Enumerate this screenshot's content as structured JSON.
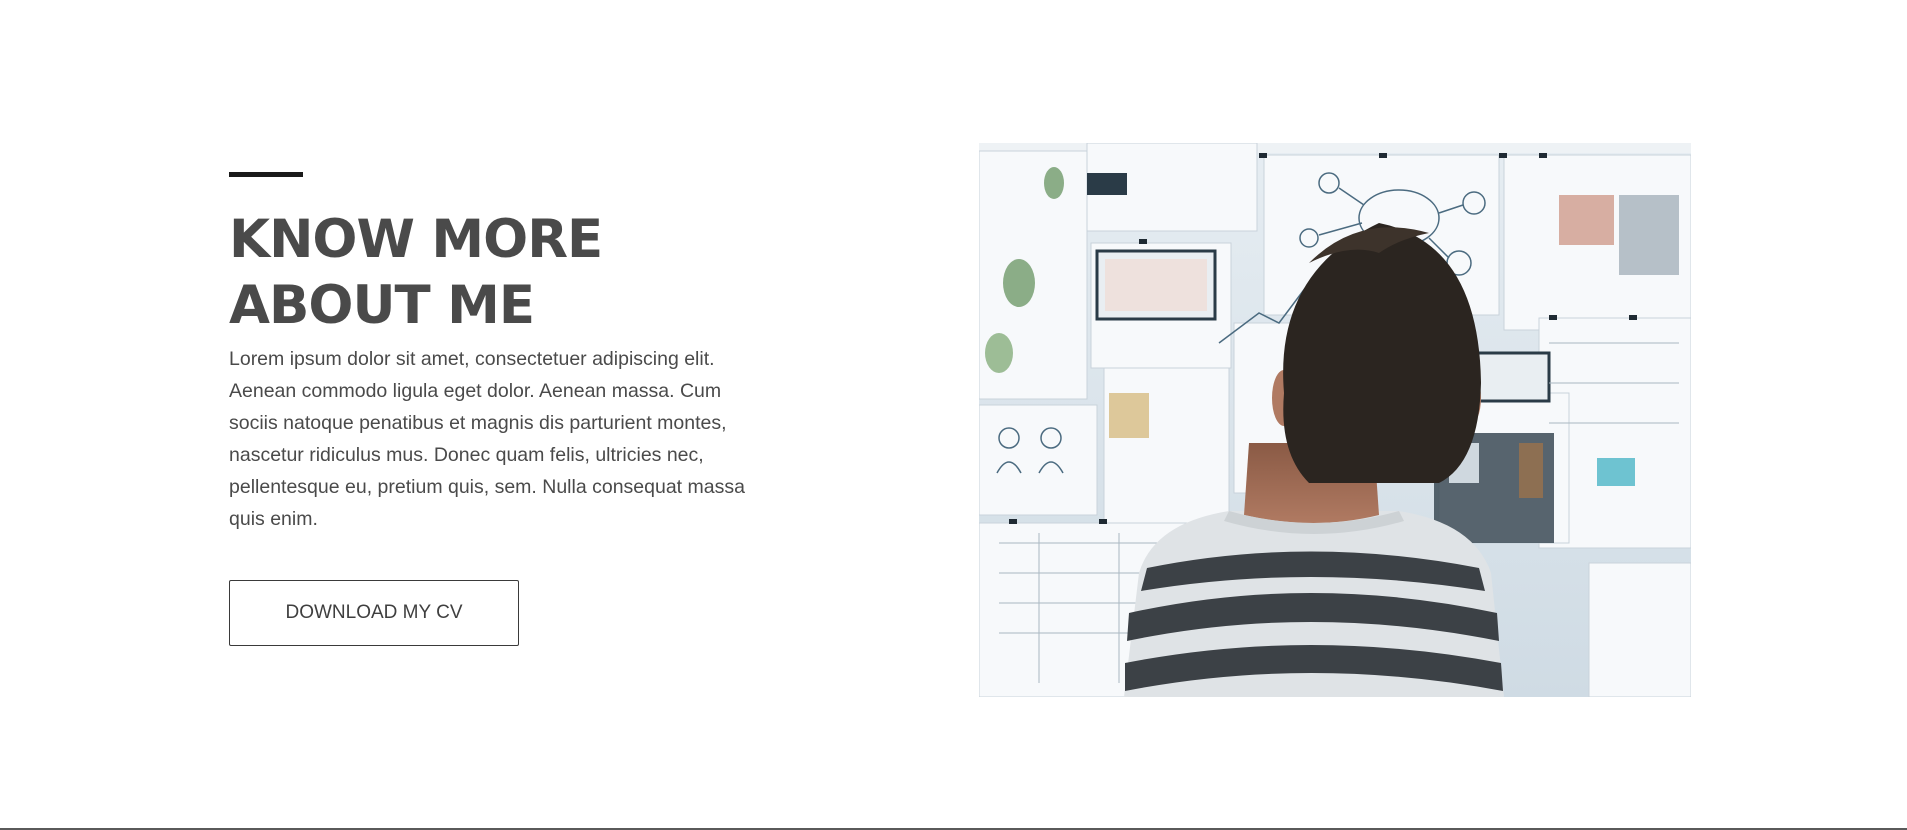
{
  "about": {
    "heading_line1": "KNOW MORE",
    "heading_line2": "ABOUT ME",
    "body": "Lorem ipsum dolor sit amet, consectetuer adipiscing elit. Aenean commodo ligula eget dolor. Aenean massa. Cum sociis natoque penatibus et magnis dis parturient montes, nascetur ridiculus mus. Donec quam felis, ultricies nec, pellentesque eu, pretium quis, sem. Nulla consequat massa quis enim.",
    "button_label": "DOWNLOAD MY CV"
  },
  "colors": {
    "text": "#4a4a4a",
    "accent_bar": "#1a1a1a",
    "button_border": "#3a3a3a",
    "background": "#ffffff"
  }
}
